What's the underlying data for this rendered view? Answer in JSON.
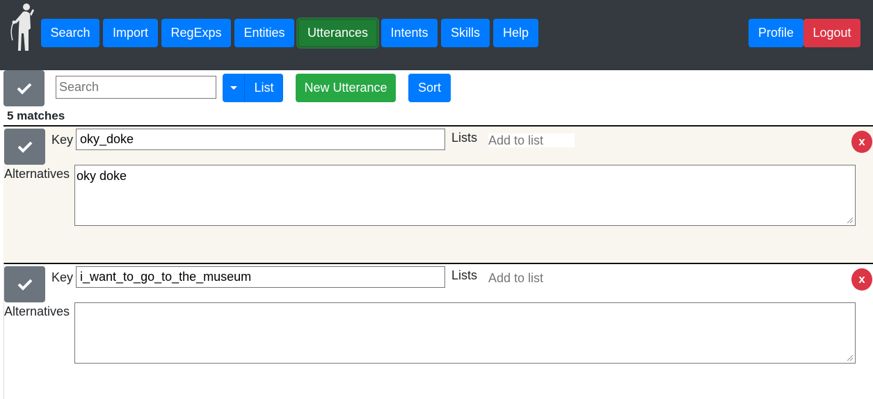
{
  "nav": {
    "items": [
      {
        "label": "Search"
      },
      {
        "label": "Import"
      },
      {
        "label": "RegExps"
      },
      {
        "label": "Entities"
      },
      {
        "label": "Utterances",
        "active": true
      },
      {
        "label": "Intents"
      },
      {
        "label": "Skills"
      },
      {
        "label": "Help"
      }
    ],
    "profile_label": "Profile",
    "logout_label": "Logout"
  },
  "toolbar": {
    "search_placeholder": "Search",
    "search_value": "",
    "list_label": "List",
    "new_label": "New Utterance",
    "sort_label": "Sort",
    "check_icon": "check-icon",
    "dropdown_icon": "caret-down-icon"
  },
  "matches_text": "5 matches",
  "utterances": [
    {
      "key_label": "Key",
      "key": "oky_doke",
      "lists_label": "Lists",
      "add_to_list": "Add to list",
      "alternatives_label": "Alternatives",
      "alternatives": "oky doke",
      "delete_label": "x"
    },
    {
      "key_label": "Key",
      "key": "i_want_to_go_to_the_museum",
      "lists_label": "Lists",
      "add_to_list": "Add to list",
      "alternatives_label": "Alternatives",
      "alternatives": "",
      "delete_label": "x"
    }
  ],
  "colors": {
    "navbar": "#343a40",
    "primary": "#007bff",
    "success": "#28a745",
    "active": "#1e7e34",
    "danger": "#dc3545",
    "secondary": "#6c757d",
    "card_highlight": "#f8f6ee"
  }
}
